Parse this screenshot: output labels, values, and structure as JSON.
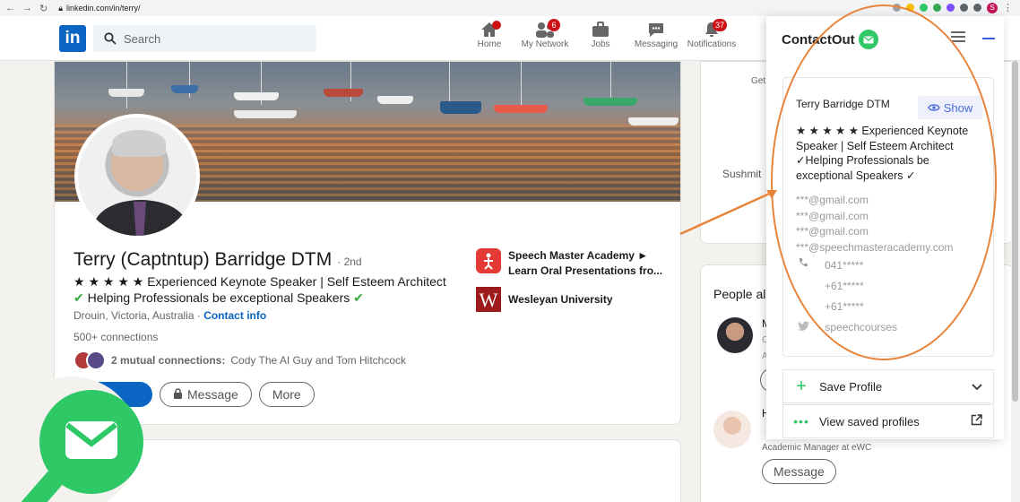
{
  "browser": {
    "url": "linkedin.com/in/terry/",
    "profile_initial": "S"
  },
  "linkedin": {
    "logo_text": "in",
    "search": {
      "placeholder": "Search"
    },
    "nav": [
      {
        "label": "Home",
        "icon": "home-icon",
        "badge": ""
      },
      {
        "label": "My Network",
        "icon": "network-icon",
        "badge": "6"
      },
      {
        "label": "Jobs",
        "icon": "briefcase-icon",
        "badge": ""
      },
      {
        "label": "Messaging",
        "icon": "chat-icon",
        "badge": ""
      },
      {
        "label": "Notifications",
        "icon": "bell-icon",
        "badge": "37"
      }
    ]
  },
  "profile": {
    "name": "Terry (Captntup) Barridge DTM",
    "degree": "· 2nd",
    "headline_line1": "★ ★ ★ ★ ★ Experienced Keynote Speaker | Self Esteem Architect",
    "headline_line2": "Helping Professionals be exceptional Speakers",
    "location": "Drouin, Victoria, Australia ·",
    "contact_info": "Contact info",
    "connections": "500+ connections",
    "mutual_label": "2 mutual connections:",
    "mutual_names": "Cody The AI Guy and Tom Hitchcock",
    "message_button": "Message",
    "more_button": "More",
    "experience": [
      {
        "name": "Speech Master Academy ►",
        "name2": "Learn Oral Presentations fro..."
      },
      {
        "name": "Wesleyan University"
      }
    ]
  },
  "sidebar": {
    "get_text": "Get",
    "sushmita_text": "Sushmit",
    "people_title": "People al",
    "person2_initial": "H",
    "person2_title": "Academic Manager at eWC",
    "message_button": "Message",
    "m_initial": "M",
    "c_initial": "C",
    "a_initial": "A"
  },
  "contactout": {
    "brand": "ContactOut",
    "name": "Terry Barridge DTM",
    "show_label": "Show",
    "headline": "★ ★ ★ ★ ★ Experienced Keynote Speaker | Self Esteem Architect ✓Helping Professionals be exceptional Speakers ✓",
    "emails": [
      "***@gmail.com",
      "***@gmail.com",
      "***@gmail.com",
      "***@speechmasteracademy.com"
    ],
    "phones": [
      "041*****",
      "+61*****",
      "+61*****"
    ],
    "twitter": "speechcourses",
    "save_profile": "Save Profile",
    "view_saved": "View saved profiles",
    "accent_color": "#2ec866"
  },
  "annotation_color": "#e8833a"
}
